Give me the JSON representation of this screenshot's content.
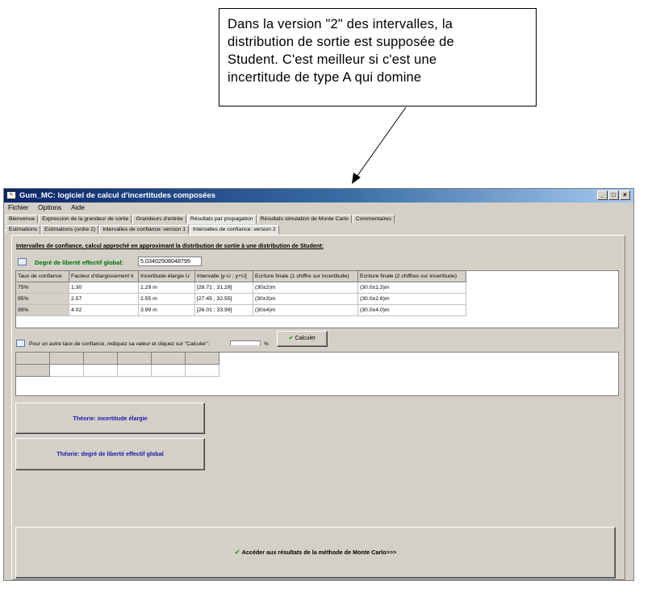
{
  "callout": {
    "lines": [
      "Dans la version \"2\" des intervalles, la",
      "distribution de sortie est supposée de",
      "Student. C'est meilleur si c'est une",
      "incertitude de type A qui domine"
    ]
  },
  "window": {
    "title": "Gum_MC: logiciel de calcul d'incertitudes composées",
    "controls": {
      "minimize": "_",
      "maximize": "□",
      "close": "×"
    },
    "menu": [
      "Fichier",
      "Options",
      "Aide"
    ]
  },
  "tabs": {
    "main": [
      "Bienvenue",
      "Expression de la grandeur de sortie",
      "Grandeurs d'entrée",
      "Résultats par propagation",
      "Résultats simulation de Monte Carlo",
      "Commentaires"
    ],
    "main_active": 3,
    "sub": [
      "Estimations",
      "Estimations (ordre 2)",
      "Intervalles de confiance: version 1",
      "Intervalles de confiance: version 2"
    ],
    "sub_active": 3
  },
  "panel": {
    "heading": "Intervalles de confiance, calcul approché en approximant la distribution de sortie à une distribution de Student:",
    "dof_label": "Degré de liberté effectif global:",
    "dof_value": "5.03402508048795",
    "table": {
      "headers": [
        "Taux de confiance",
        "Facteur d'élargissement k",
        "Incertitude élargie U",
        "Intervalle [y-U ; y+U]",
        "Ecriture finale (1 chiffre sur incertitude)",
        "Ecriture finale (2 chiffres sur incertitude)"
      ],
      "rows": [
        [
          "75%",
          "1.30",
          "1.29 m",
          "[28.71 ; 31.29]",
          "(30±2)m",
          "(30.0±1.3)m"
        ],
        [
          "95%",
          "2.57",
          "2.55 m",
          "[27.45 ; 32.55]",
          "(30±3)m",
          "(30.0±2.6)m"
        ],
        [
          "99%",
          "4.02",
          "3.99 m",
          "[26.01 ; 33.99]",
          "(30±4)m",
          "(30.0±4.0)m"
        ]
      ]
    },
    "other_label": "Pour un autre taux de confiance, indiquez sa valeur et cliquez sur \"Calculer\":",
    "other_value": "",
    "other_unit": "%",
    "calc_button": "Calculer",
    "theory_button_1": "Théorie: incertitude élargie",
    "theory_button_2": "Théorie: degré de liberté effectif global",
    "monte_carlo_button": "Accéder aux résultats de la méthode de Monte Carlo>>>",
    "check_glyph": "✔"
  },
  "colors": {
    "title_start": "#0a246a",
    "title_end": "#a6caf0",
    "dof_label": "#007000",
    "theory_text": "#1a1aa8",
    "check": "#2e9a2e"
  }
}
